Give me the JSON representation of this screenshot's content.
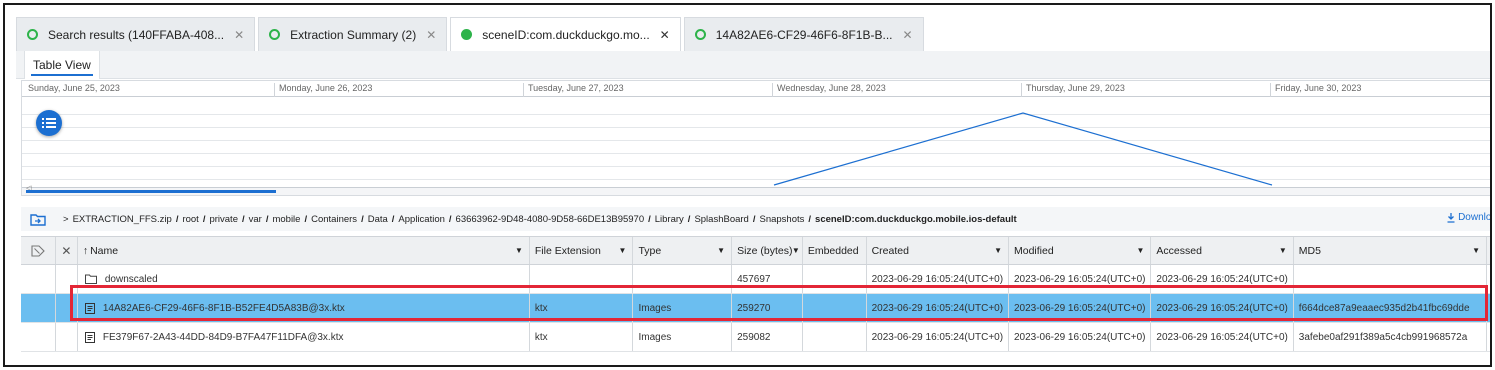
{
  "tabs": [
    {
      "label": "Search results (140FFABA-408...",
      "status": "ring",
      "active": false
    },
    {
      "label": "Extraction Summary (2)",
      "status": "ring",
      "active": false
    },
    {
      "label": "sceneID:com.duckduckgo.mo...",
      "status": "filled",
      "active": true
    },
    {
      "label": "14A82AE6-CF29-46F6-8F1B-B...",
      "status": "ring",
      "active": false
    }
  ],
  "view": {
    "active_label": "Table View"
  },
  "timeline": {
    "days": [
      "Sunday, June 25, 2023",
      "Monday, June 26, 2023",
      "Tuesday, June 27, 2023",
      "Wednesday, June 28, 2023",
      "Thursday, June 29, 2023",
      "Friday, June 30, 2023"
    ],
    "peak_day": "Thursday, June 29, 2023",
    "scroll_left_glyph": "◁"
  },
  "path": {
    "prefix": ">",
    "segments": [
      "EXTRACTION_FFS.zip",
      "root",
      "private",
      "var",
      "mobile",
      "Containers",
      "Data",
      "Application",
      "63663962-9D48-4080-9D58-66DE13B95970",
      "Library",
      "SplashBoard",
      "Snapshots"
    ],
    "separator": "/",
    "current": "sceneID:com.duckduckgo.mobile.ios-default",
    "download_label": "Downloa"
  },
  "columns": {
    "name": "Name",
    "file_extension": "File Extension",
    "type": "Type",
    "size": "Size (bytes)",
    "embedded": "Embedded",
    "created": "Created",
    "modified": "Modified",
    "accessed": "Accessed",
    "md5": "MD5"
  },
  "rows": [
    {
      "icon": "folder-icon",
      "name": "downscaled",
      "ext": "",
      "type": "",
      "size": "457697",
      "embedded": "",
      "created": "2023-06-29 16:05:24(UTC+0)",
      "modified": "2023-06-29 16:05:24(UTC+0)",
      "accessed": "2023-06-29 16:05:24(UTC+0)",
      "md5": "",
      "selected": false
    },
    {
      "icon": "file-icon",
      "name": "14A82AE6-CF29-46F6-8F1B-B52FE4D5A83B@3x.ktx",
      "ext": "ktx",
      "type": "Images",
      "size": "259270",
      "embedded": "",
      "created": "2023-06-29 16:05:24(UTC+0)",
      "modified": "2023-06-29 16:05:24(UTC+0)",
      "accessed": "2023-06-29 16:05:24(UTC+0)",
      "md5": "f664dce87a9eaaec935d2b41fbc69dde",
      "selected": true
    },
    {
      "icon": "file-icon",
      "name": "FE379F67-2A43-44DD-84D9-B7FA47F11DFA@3x.ktx",
      "ext": "ktx",
      "type": "Images",
      "size": "259082",
      "embedded": "",
      "created": "2023-06-29 16:05:24(UTC+0)",
      "modified": "2023-06-29 16:05:24(UTC+0)",
      "accessed": "2023-06-29 16:05:24(UTC+0)",
      "md5": "3afebe0af291f389a5c4cb991968572a",
      "selected": false
    }
  ],
  "colors": {
    "accent": "#1c6fd1",
    "tab_status": "#2db34a",
    "selection": "#6bbef0",
    "highlight": "#e32636"
  }
}
